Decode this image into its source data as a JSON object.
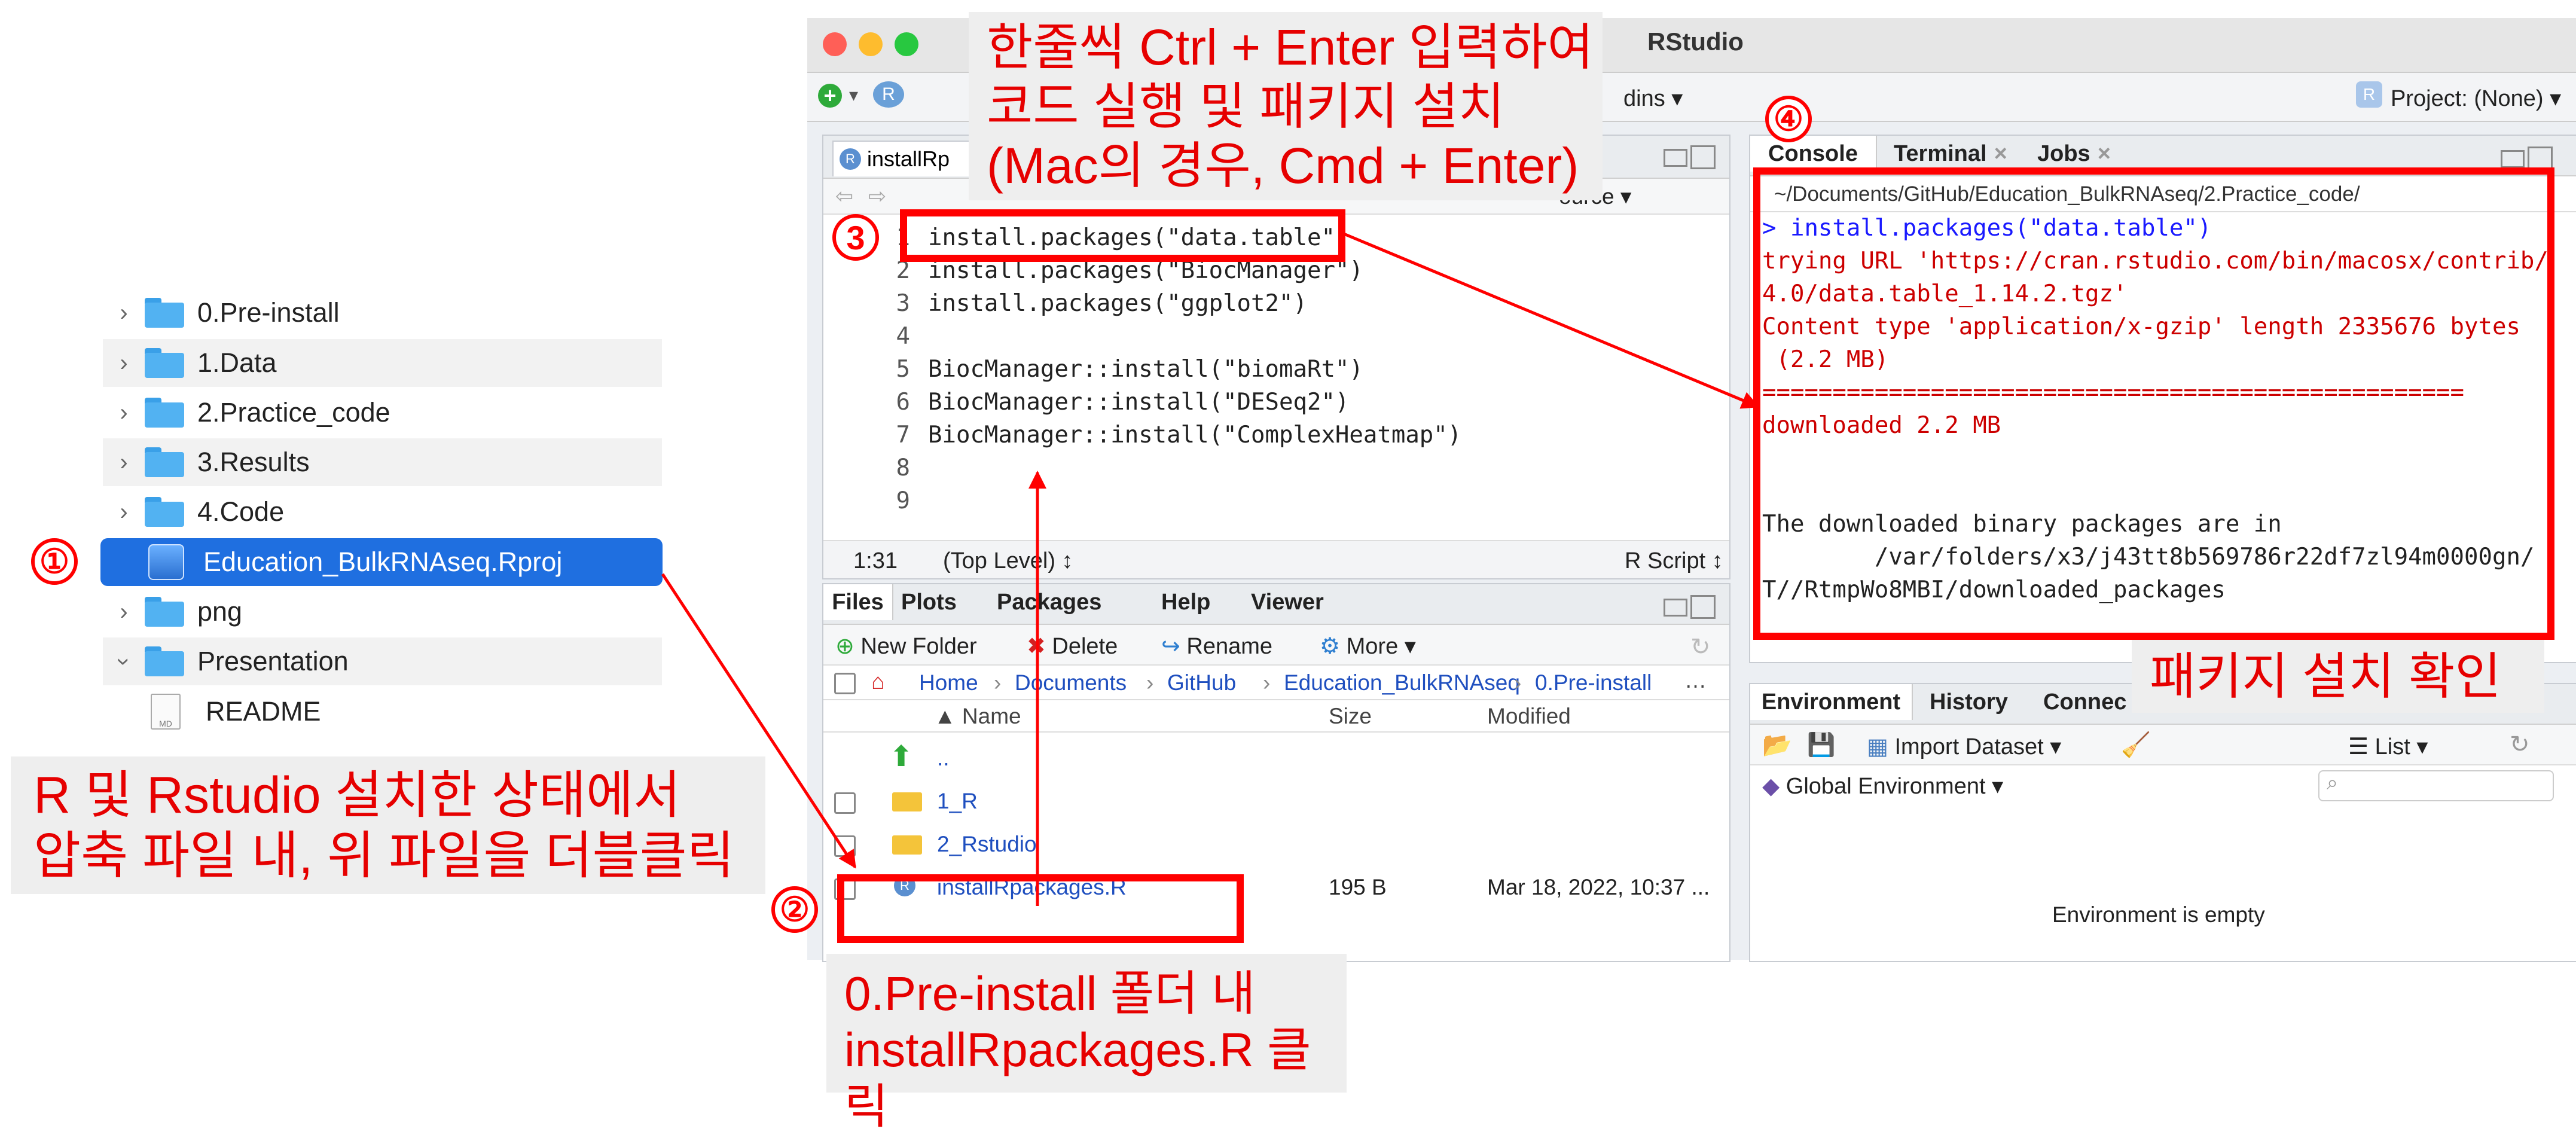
{
  "finder": {
    "items": [
      {
        "label": "0.Pre-install"
      },
      {
        "label": "1.Data"
      },
      {
        "label": "2.Practice_code"
      },
      {
        "label": "3.Results"
      },
      {
        "label": "4.Code"
      },
      {
        "label": "Education_BulkRNAseq.Rproj"
      },
      {
        "label": "png"
      },
      {
        "label": "Presentation"
      },
      {
        "label": "README"
      }
    ],
    "readme_icon_text": "MD"
  },
  "rstudio": {
    "title": "RStudio",
    "addins_label": "dins",
    "project_label": "Project: (None)",
    "source_tab": "installRp",
    "source_btn": "ource",
    "editor": {
      "lines": [
        "install.packages(\"data.table\")",
        "install.packages(\"BiocManager\")",
        "install.packages(\"ggplot2\")",
        "",
        "BiocManager::install(\"biomaRt\")",
        "BiocManager::install(\"DESeq2\")",
        "BiocManager::install(\"ComplexHeatmap\")",
        "",
        ""
      ],
      "line_numbers": [
        "1",
        "2",
        "3",
        "4",
        "5",
        "6",
        "7",
        "8",
        "9"
      ],
      "cursor_pos": "1:31",
      "scope": "(Top Level) ↕",
      "filetype": "R Script ↕"
    },
    "files_pane": {
      "tabs": [
        "Files",
        "Plots",
        "Packages",
        "Help",
        "Viewer"
      ],
      "toolbar": {
        "new_folder": "New Folder",
        "delete": "Delete",
        "rename": "Rename",
        "more": "More"
      },
      "breadcrumb": [
        "Home",
        "Documents",
        "GitHub",
        "Education_BulkRNAseq",
        "0.Pre-install"
      ],
      "columns": {
        "name": "▲ Name",
        "size": "Size",
        "modified": "Modified"
      },
      "rows": [
        {
          "name": "..",
          "size": "",
          "modified": ""
        },
        {
          "name": "1_R",
          "size": "",
          "modified": ""
        },
        {
          "name": "2_Rstudio",
          "size": "",
          "modified": ""
        },
        {
          "name": "installRpackages.R",
          "size": "195 B",
          "modified": "Mar 18, 2022, 10:37 ..."
        }
      ]
    },
    "console": {
      "tabs": [
        "Console",
        "Terminal",
        "Jobs"
      ],
      "path": "~/Documents/GitHub/Education_BulkRNAseq/2.Practice_code/",
      "lines": [
        {
          "text": "> install.packages(\"data.table\")",
          "color": "#1a1aff"
        },
        {
          "text": "trying URL 'https://cran.rstudio.com/bin/macosx/contrib/",
          "color": "#cc0000"
        },
        {
          "text": "4.0/data.table_1.14.2.tgz'",
          "color": "#cc0000"
        },
        {
          "text": "Content type 'application/x-gzip' length 2335676 bytes",
          "color": "#cc0000"
        },
        {
          "text": " (2.2 MB)",
          "color": "#cc0000"
        },
        {
          "text": "==================================================",
          "color": "#cc0000"
        },
        {
          "text": "downloaded 2.2 MB",
          "color": "#cc0000"
        },
        {
          "text": "",
          "color": "#222"
        },
        {
          "text": "",
          "color": "#222"
        },
        {
          "text": "The downloaded binary packages are in",
          "color": "#222"
        },
        {
          "text": "        /var/folders/x3/j43tt8b569786r22df7zl94m0000gn/",
          "color": "#222"
        },
        {
          "text": "T//RtmpWo8MBI/downloaded_packages",
          "color": "#222"
        }
      ]
    },
    "env_pane": {
      "tabs": [
        "Environment",
        "History",
        "Connec"
      ],
      "import_dataset": "Import Dataset",
      "list_label": "List",
      "global_env": "Global Environment",
      "empty": "Environment is empty"
    }
  },
  "annotations": {
    "n1": "①",
    "n2": "②",
    "n3": "3",
    "n4": "④",
    "note_left_1": "R 및 Rstudio 설치한 상태에서",
    "note_left_2": "압축 파일 내, 위 파일을 더블클릭",
    "note_top_1": "한줄씩 Ctrl + Enter 입력하여",
    "note_top_2": "코드 실행 및 패키지 설치",
    "note_top_3": "(Mac의 경우, Cmd + Enter)",
    "note_bottom_1": "0.Pre-install 폴더 내",
    "note_bottom_2": "installRpackages.R 클릭",
    "note_right": "패키지 설치 확인"
  },
  "colors": {
    "annotation": "#ff0000",
    "selection": "#1f6fe0",
    "folder": "#52b2f2"
  }
}
